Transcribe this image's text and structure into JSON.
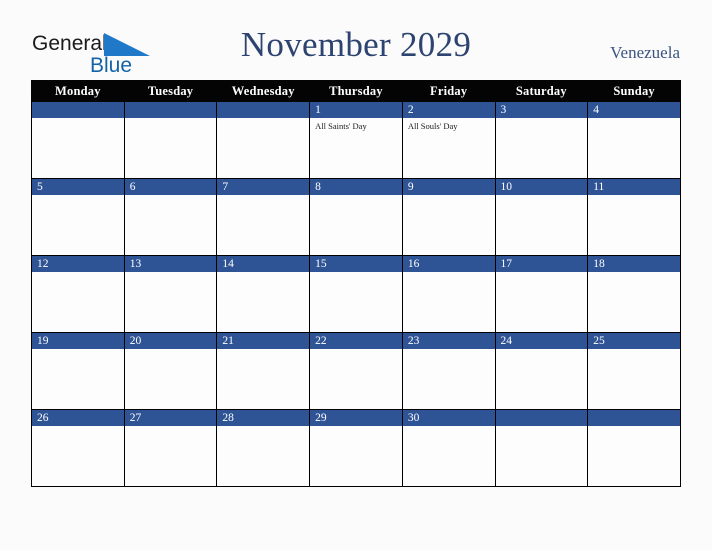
{
  "header": {
    "logo": {
      "name": "general-blue-logo",
      "text_primary": "General",
      "text_secondary": "Blue",
      "primary_color": "#1b1b1b",
      "secondary_color": "#1464a5",
      "triangle_color": "#1f78c8"
    },
    "title": "November 2029",
    "title_color": "#2d4470",
    "country": "Venezuela",
    "country_color": "#3c5580"
  },
  "colors": {
    "day_header_bg": "#040404",
    "day_header_text": "#ffffff",
    "date_bar_bg": "#2f5496",
    "date_bar_text": "#ffffff",
    "cell_bg": "#fdfdfd",
    "grid_line": "#000000",
    "page_bg": "#fbfbfb"
  },
  "calendar": {
    "day_headers": [
      "Monday",
      "Tuesday",
      "Wednesday",
      "Thursday",
      "Friday",
      "Saturday",
      "Sunday"
    ],
    "weeks": [
      [
        {
          "date": "",
          "events": []
        },
        {
          "date": "",
          "events": []
        },
        {
          "date": "",
          "events": []
        },
        {
          "date": "1",
          "events": [
            "All Saints' Day"
          ]
        },
        {
          "date": "2",
          "events": [
            "All Souls' Day"
          ]
        },
        {
          "date": "3",
          "events": []
        },
        {
          "date": "4",
          "events": []
        }
      ],
      [
        {
          "date": "5",
          "events": []
        },
        {
          "date": "6",
          "events": []
        },
        {
          "date": "7",
          "events": []
        },
        {
          "date": "8",
          "events": []
        },
        {
          "date": "9",
          "events": []
        },
        {
          "date": "10",
          "events": []
        },
        {
          "date": "11",
          "events": []
        }
      ],
      [
        {
          "date": "12",
          "events": []
        },
        {
          "date": "13",
          "events": []
        },
        {
          "date": "14",
          "events": []
        },
        {
          "date": "15",
          "events": []
        },
        {
          "date": "16",
          "events": []
        },
        {
          "date": "17",
          "events": []
        },
        {
          "date": "18",
          "events": []
        }
      ],
      [
        {
          "date": "19",
          "events": []
        },
        {
          "date": "20",
          "events": []
        },
        {
          "date": "21",
          "events": []
        },
        {
          "date": "22",
          "events": []
        },
        {
          "date": "23",
          "events": []
        },
        {
          "date": "24",
          "events": []
        },
        {
          "date": "25",
          "events": []
        }
      ],
      [
        {
          "date": "26",
          "events": []
        },
        {
          "date": "27",
          "events": []
        },
        {
          "date": "28",
          "events": []
        },
        {
          "date": "29",
          "events": []
        },
        {
          "date": "30",
          "events": []
        },
        {
          "date": "",
          "events": []
        },
        {
          "date": "",
          "events": []
        }
      ]
    ]
  }
}
